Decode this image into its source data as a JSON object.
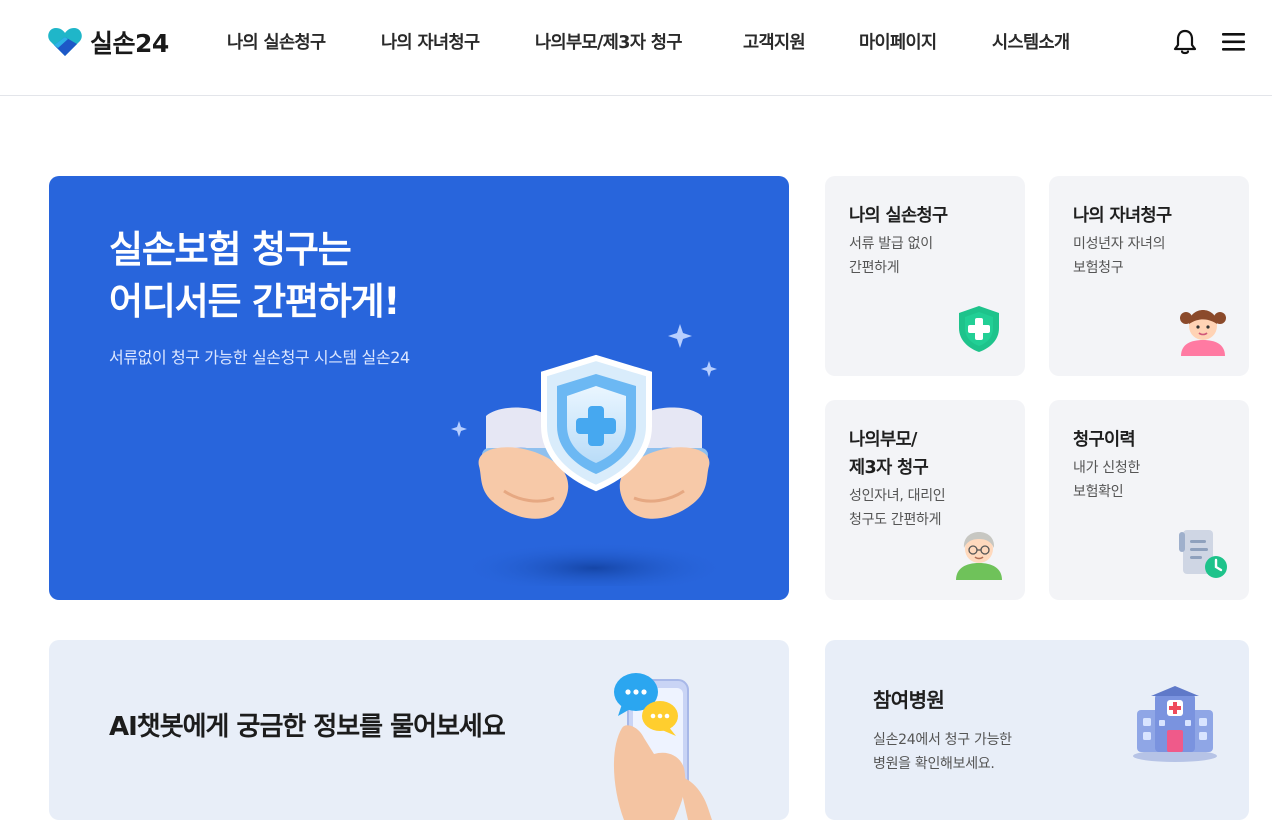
{
  "brand": {
    "name": "실손24",
    "logo_icon": "heart-logo-icon"
  },
  "nav": {
    "items": [
      {
        "label": "나의 실손청구"
      },
      {
        "label": "나의 자녀청구"
      },
      {
        "label": "나의부모/제3자 청구"
      },
      {
        "label": "고객지원"
      },
      {
        "label": "마이페이지"
      },
      {
        "label": "시스템소개"
      }
    ],
    "bell_icon": "bell-icon",
    "menu_icon": "hamburger-menu-icon"
  },
  "hero": {
    "title_line1": "실손보험 청구는",
    "title_line2": "어디서든 간편하게!",
    "subtitle": "서류없이 청구 가능한 실손청구 시스템 실손24",
    "illustration": "hands-holding-shield-illustration"
  },
  "cards": [
    {
      "title": "나의 실손청구",
      "desc": "서류 발급 없이\n간편하게",
      "icon": "shield-plus-icon"
    },
    {
      "title": "나의 자녀청구",
      "desc": "미성년자 자녀의\n보험청구",
      "icon": "child-icon"
    },
    {
      "title": "나의부모/\n제3자 청구",
      "desc": "성인자녀, 대리인\n청구도 간편하게",
      "icon": "grandparent-icon"
    },
    {
      "title": "청구이력",
      "desc": "내가 신청한\n보험확인",
      "icon": "document-clock-icon"
    }
  ],
  "chatbot": {
    "title": "AI챗봇에게 궁금한 정보를 물어보세요",
    "illustration": "phone-chat-bubbles-illustration"
  },
  "hospital": {
    "title": "참여병원",
    "desc": "실손24에서 청구 가능한\n병원을 확인해보세요.",
    "icon": "hospital-building-icon"
  },
  "colors": {
    "primary": "#2865dc",
    "card_bg": "#f3f4f7",
    "banner_bg": "#e8eef8",
    "accent_green": "#1ec38b"
  }
}
